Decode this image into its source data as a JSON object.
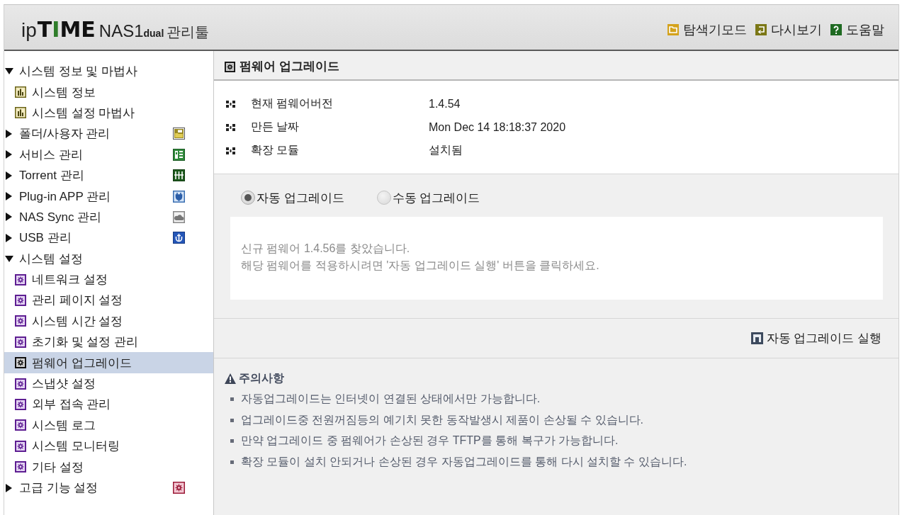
{
  "header": {
    "logo": {
      "brand": [
        {
          "text": "ip",
          "kind": "light"
        },
        {
          "text": "T",
          "kind": "heavy"
        },
        {
          "text": "I",
          "kind": "accent"
        },
        {
          "text": "ME",
          "kind": "heavy"
        }
      ],
      "model": "NAS1",
      "edition": "dual",
      "title": "관리툴"
    },
    "links": [
      {
        "label": "탐색기모드",
        "kind": "explorer"
      },
      {
        "label": "다시보기",
        "kind": "review"
      },
      {
        "label": "도움말",
        "kind": "help"
      }
    ]
  },
  "sidebar": {
    "items": [
      {
        "label": "시스템 정보 및 마법사",
        "kind": "info",
        "expanded": true,
        "children": [
          {
            "label": "시스템 정보",
            "kind": "info",
            "selected": false
          },
          {
            "label": "시스템 설정 마법사",
            "kind": "info",
            "selected": false
          }
        ]
      },
      {
        "label": "폴더/사용자 관리",
        "kind": "folders",
        "expanded": false
      },
      {
        "label": "서비스 관리",
        "kind": "services",
        "expanded": false
      },
      {
        "label": "Torrent 관리",
        "kind": "torrent",
        "expanded": false
      },
      {
        "label": "Plug-in APP 관리",
        "kind": "plugins",
        "expanded": false
      },
      {
        "label": "NAS Sync 관리",
        "kind": "sync",
        "expanded": false
      },
      {
        "label": "USB 관리",
        "kind": "usb",
        "expanded": false
      },
      {
        "label": "시스템 설정",
        "kind": "settings",
        "expanded": true,
        "children": [
          {
            "label": "네트워크 설정",
            "kind": "settings",
            "selected": false
          },
          {
            "label": "관리 페이지 설정",
            "kind": "settings",
            "selected": false
          },
          {
            "label": "시스템 시간 설정",
            "kind": "settings",
            "selected": false
          },
          {
            "label": "초기화 및 설정 관리",
            "kind": "settings",
            "selected": false
          },
          {
            "label": "펌웨어 업그레이드",
            "kind": "settings",
            "selected": true
          },
          {
            "label": "스냅샷 설정",
            "kind": "settings",
            "selected": false
          },
          {
            "label": "외부 접속 관리",
            "kind": "settings",
            "selected": false
          },
          {
            "label": "시스템 로그",
            "kind": "settings",
            "selected": false
          },
          {
            "label": "시스템 모니터링",
            "kind": "settings",
            "selected": false
          },
          {
            "label": "기타 설정",
            "kind": "settings",
            "selected": false
          }
        ]
      },
      {
        "label": "고급 기능 설정",
        "kind": "advanced",
        "expanded": false
      }
    ]
  },
  "page": {
    "title": "펌웨어 업그레이드",
    "info": [
      {
        "label": "현재 펌웨어버전",
        "value": "1.4.54"
      },
      {
        "label": "만든 날짜",
        "value": "Mon Dec 14 18:18:37 2020"
      },
      {
        "label": "확장 모듈",
        "value": "설치됨"
      }
    ],
    "modes": [
      {
        "label": "자동 업그레이드",
        "selected": true
      },
      {
        "label": "수동 업그레이드",
        "selected": false
      }
    ],
    "message": [
      "신규 펌웨어 1.4.56를 찾았습니다.",
      "해당 펌웨어를 적용하시려면 '자동 업그레이드 실행' 버튼을 클릭하세요."
    ],
    "action": "자동 업그레이드 실행",
    "notice": {
      "title": "주의사항",
      "items": [
        "자동업그레이드는 인터넷이 연결된 상태에서만 가능합니다.",
        "업그레이드중 전원꺼짐등의 예기치 못한 동작발생시 제품이 손상될 수 있습니다.",
        "만약 업그레이드 중 펌웨어가 손상된 경우 TFTP를 통해 복구가 가능합니다.",
        "확장 모듈이 설치 안되거나 손상된 경우 자동업그레이드를 통해 다시 설치할 수 있습니다."
      ]
    }
  }
}
